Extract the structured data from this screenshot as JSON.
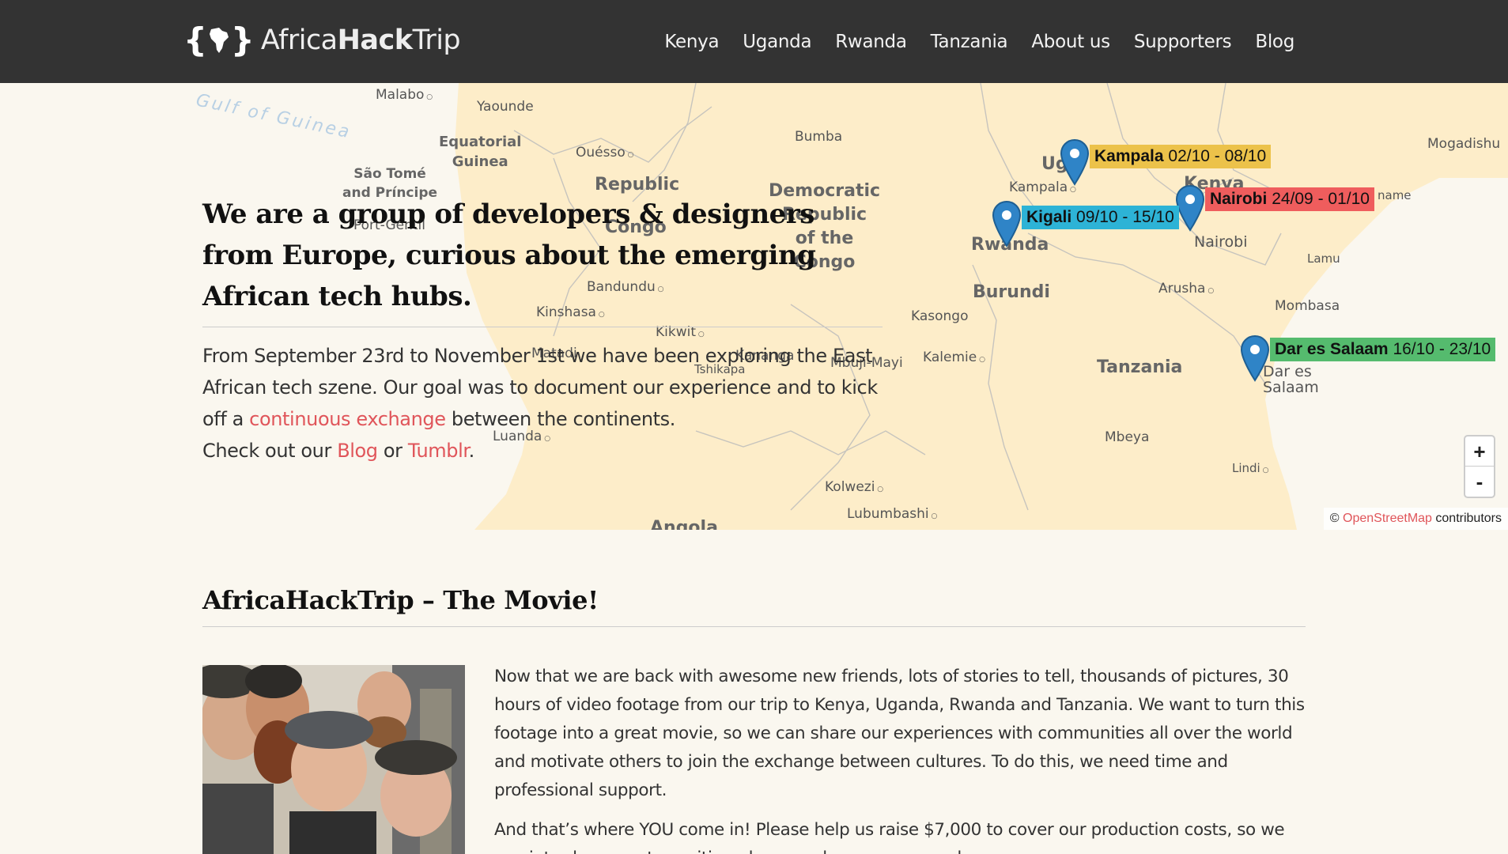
{
  "header": {
    "logo_prefix": "Africa",
    "logo_bold": "Hack",
    "logo_suffix": "Trip",
    "nav": [
      "Kenya",
      "Uganda",
      "Rwanda",
      "Tanzania",
      "About us",
      "Supporters",
      "Blog"
    ]
  },
  "hero": {
    "title": "We are a group of developers & designers from Europe, curious about the emerging African tech hubs.",
    "body_1": "From September 23rd to November 1st we have been exploring the East African tech szene. Our goal was to document our experience and to kick off a ",
    "link_exchange": "continuous exchange",
    "body_2": " between the continents.",
    "body_3": "Check out our ",
    "link_blog": "Blog",
    "body_or": " or ",
    "link_tumblr": "Tumblr",
    "body_end": "."
  },
  "map": {
    "labels": {
      "malabo": "Malabo",
      "yaounde": "Yaounde",
      "gulf": "Gulf of Guinea",
      "eqguinea": "Equatorial\nGuinea",
      "ouesso": "Ouésso",
      "bumba": "Bumba",
      "saotome": "São Tomé\nand Príncipe",
      "portgentil": "Port-Gentil",
      "republic": "Republic",
      "congo": "Congo",
      "drc": "Democratic\nRepublic\nof the\nCongo",
      "bandundu": "Bandundu",
      "kinshasa": "Kinshasa",
      "kikwit": "Kikwit",
      "matadi": "Matadi",
      "tshikapa": "Tshikapa",
      "kananga": "Kananga",
      "mbujimayi": "Mbuji-Mayi",
      "kalemie": "Kalemie",
      "kasongo": "Kasongo",
      "luanda": "Luanda",
      "kolwezi": "Kolwezi",
      "lubumbashi": "Lubumbashi",
      "angola": "Angola",
      "uganda": "Ug",
      "kampala": "Kampala",
      "rwanda": "Rwanda",
      "burundi": "Burundi",
      "kenya": "Kenya",
      "nairobi": "Nairobi",
      "arusha": "Arusha",
      "mombasa": "Mombasa",
      "lamu": "Lamu",
      "mogadishu": "Mogadishu",
      "tanzania": "Tanzania",
      "dar": "Dar es\nSalaam",
      "mbeya": "Mbeya",
      "lindi": "Lindi",
      "name": "name"
    },
    "pins": [
      {
        "city": "Kampala",
        "dates": "02/10 - 08/10",
        "color": "#ecc24a"
      },
      {
        "city": "Nairobi",
        "dates": "24/09 - 01/10",
        "color": "#ef5d5d"
      },
      {
        "city": "Kigali",
        "dates": "09/10 - 15/10",
        "color": "#2db3d6"
      },
      {
        "city": "Dar es Salaam",
        "dates": "16/10 - 23/10",
        "color": "#55bb6e"
      }
    ],
    "zoom_in": "+",
    "zoom_out": "-",
    "attribution_prefix": "© ",
    "attribution_link": "OpenStreetMap",
    "attribution_suffix": " contributors"
  },
  "movie": {
    "title": "AfricaHackTrip – The Movie!",
    "para_1": "Now that we are back with awesome new friends, lots of stories to tell, thousands of pictures, 30 hours of video footage from our trip to Kenya, Uganda, Rwanda and Tanzania. We want to turn this footage into a great movie, so we can share our experiences with communities all over the world and motivate others to join the exchange between cultures. To do this, we need time and professional support.",
    "para_2": "And that’s where YOU come in! Please help us raise $7,000 to cover our production costs, so we can introduce you to exciting places and awesome people."
  },
  "colors": {
    "header_bg": "#333333",
    "link": "#e0555a",
    "land": "#fdedc9",
    "water": "#faf7ef"
  }
}
